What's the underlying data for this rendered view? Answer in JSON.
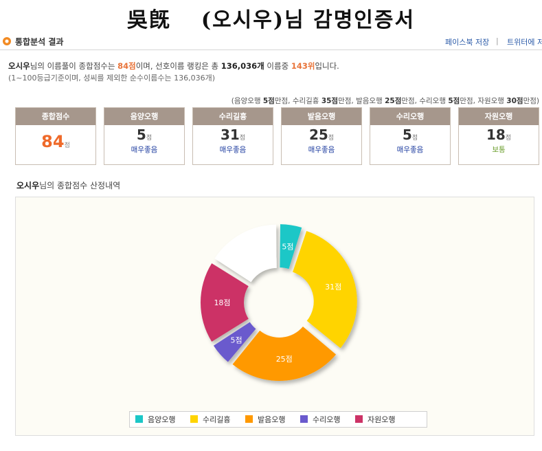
{
  "certificate": {
    "hanja_name": "吳旣",
    "title": "(오시우)님 감명인증서"
  },
  "section": {
    "heading": "통합분석 결과",
    "share_facebook": "페이스북 저장",
    "separator": "|",
    "share_twitter": "트위터에 저장"
  },
  "summary": {
    "name": "오시우",
    "text1": "님의 이름풀이 종합점수는 ",
    "total_score": "84점",
    "text2": "이며, 선호이름 랭킹은 총 ",
    "total_names": "136,036개",
    "text3": " 이름중 ",
    "rank": "143위",
    "text4": "입니다.",
    "note": "(1~100등급기준이며, 성씨를 제외한 순수이름수는 136,036개)"
  },
  "max_scores": [
    {
      "label": "음양오행 ",
      "value": "5점",
      "suffix": "만점, "
    },
    {
      "label": "수리길흉 ",
      "value": "35점",
      "suffix": "만점, "
    },
    {
      "label": "발음오행 ",
      "value": "25점",
      "suffix": "만점, "
    },
    {
      "label": "수리오행 ",
      "value": "5점",
      "suffix": "만점, "
    },
    {
      "label": "자원오행 ",
      "value": "30점",
      "suffix": "만점)"
    }
  ],
  "max_scores_prefix": "(",
  "cards": [
    {
      "label": "종합점수",
      "score": "84",
      "unit": "점",
      "grade": ""
    },
    {
      "label": "음양오행",
      "score": "5",
      "unit": "점",
      "grade": "매우좋음"
    },
    {
      "label": "수리길흉",
      "score": "31",
      "unit": "점",
      "grade": "매우좋음"
    },
    {
      "label": "발음오행",
      "score": "25",
      "unit": "점",
      "grade": "매우좋음"
    },
    {
      "label": "수리오행",
      "score": "5",
      "unit": "점",
      "grade": "매우좋음"
    },
    {
      "label": "자원오행",
      "score": "18",
      "unit": "점",
      "grade": "보통"
    }
  ],
  "breakdown": {
    "name": "오시우",
    "suffix": "님의 종합점수 산정내역"
  },
  "colors": {
    "header_bar": "#a6978c",
    "total_score": "#ef6a2a",
    "grade_good": "#1b3a9e",
    "grade_normal": "#6b9e2c"
  },
  "chart_data": {
    "type": "pie",
    "donut": true,
    "total": 100,
    "slices": [
      {
        "name": "음양오행",
        "value": 5,
        "label": "5점",
        "color": "#1cc7c7"
      },
      {
        "name": "수리길흉",
        "value": 31,
        "label": "31점",
        "color": "#ffd400"
      },
      {
        "name": "발음오행",
        "value": 25,
        "label": "25점",
        "color": "#ff9900"
      },
      {
        "name": "수리오행",
        "value": 5,
        "label": "5점",
        "color": "#6a5acd"
      },
      {
        "name": "자원오행",
        "value": 18,
        "label": "18점",
        "color": "#cc3366"
      }
    ],
    "remainder_color": "#ffffff",
    "legend_position": "bottom"
  }
}
